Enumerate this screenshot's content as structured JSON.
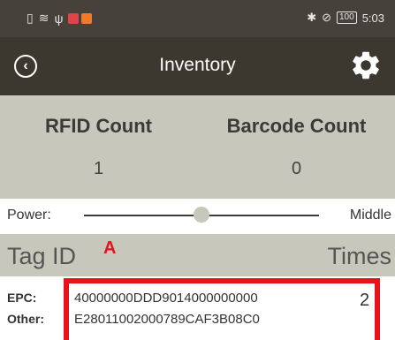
{
  "status_bar": {
    "clock": "5:03",
    "battery": "100",
    "bluetooth_icon": "bluetooth-icon",
    "mute_icon": "mute-icon"
  },
  "title_bar": {
    "title": "Inventory",
    "back_icon": "back-circle-icon",
    "settings_icon": "gear-icon"
  },
  "counts": {
    "rfid_label": "RFID Count",
    "rfid_value": "1",
    "barcode_label": "Barcode Count",
    "barcode_value": "0"
  },
  "power": {
    "label": "Power:",
    "value": "Middle",
    "level": 0.5
  },
  "tag_table": {
    "tag_id_header": "Tag ID",
    "times_header": "Times",
    "annotation": "A",
    "rows": [
      {
        "epc_label": "EPC:",
        "epc": "40000000DDD9014000000000",
        "other_label": "Other:",
        "other": "E28011002000789CAF3B08C0",
        "times": "2"
      }
    ]
  },
  "colors": {
    "status_bar": "#46413a",
    "title_bar": "#3c3830",
    "panel": "#c8c7bb",
    "highlight": "#e8131a"
  }
}
